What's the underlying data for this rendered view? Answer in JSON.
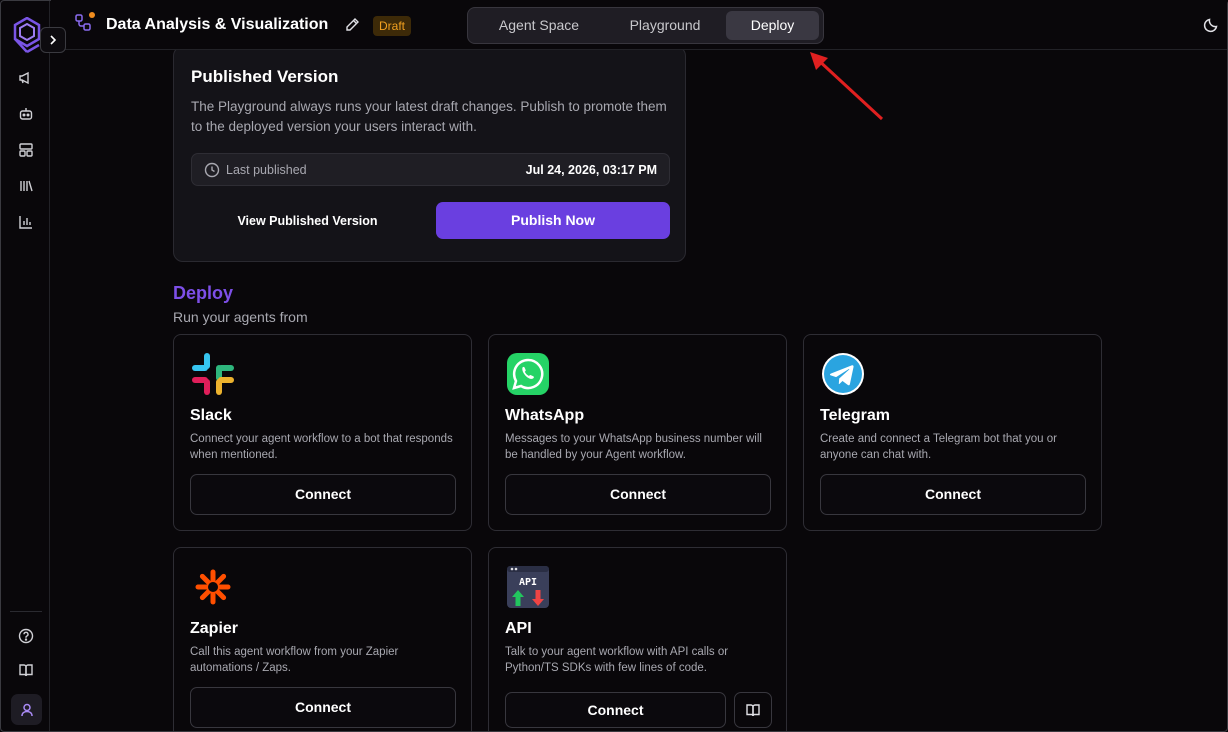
{
  "header": {
    "title": "Data Analysis & Visualization",
    "badge": "Draft",
    "tabs": [
      {
        "label": "Agent Space",
        "active": false
      },
      {
        "label": "Playground",
        "active": false
      },
      {
        "label": "Deploy",
        "active": true
      }
    ]
  },
  "published": {
    "title": "Published Version",
    "description": "The Playground always runs your latest draft changes. Publish to promote them to the deployed version your users interact with.",
    "last_published_label": "Last published",
    "last_published_date": "Jul 24, 2026, 03:17 PM",
    "view_button": "View Published Version",
    "publish_button": "Publish Now"
  },
  "deploy": {
    "heading": "Deploy",
    "subheading": "Run your agents from",
    "integrations": [
      {
        "name": "Slack",
        "description": "Connect your agent workflow to a bot that responds when mentioned.",
        "button": "Connect",
        "icon": "slack-icon"
      },
      {
        "name": "WhatsApp",
        "description": "Messages to your WhatsApp business number will be handled by your Agent workflow.",
        "button": "Connect",
        "icon": "whatsapp-icon"
      },
      {
        "name": "Telegram",
        "description": "Create and connect a Telegram bot that you or anyone can chat with.",
        "button": "Connect",
        "icon": "telegram-icon"
      },
      {
        "name": "Zapier",
        "description": "Call this agent workflow from your Zapier automations / Zaps.",
        "button": "Connect",
        "icon": "zapier-icon"
      },
      {
        "name": "API",
        "description": "Talk to your agent workflow with API calls or Python/TS SDKs with few lines of code.",
        "button": "Connect",
        "icon": "api-icon",
        "icon_text": "API"
      }
    ]
  },
  "colors": {
    "accent": "#6a3fe0",
    "deploy_heading": "#7d4fe8",
    "draft_badge_text": "#f0a020",
    "background": "#09070a",
    "annotation_arrow": "#e02020"
  },
  "sidebar": {
    "icons": [
      "logo-icon",
      "megaphone-icon",
      "bot-icon",
      "layout-icon",
      "library-icon",
      "chart-icon",
      "help-icon",
      "book-icon",
      "user-icon"
    ]
  }
}
